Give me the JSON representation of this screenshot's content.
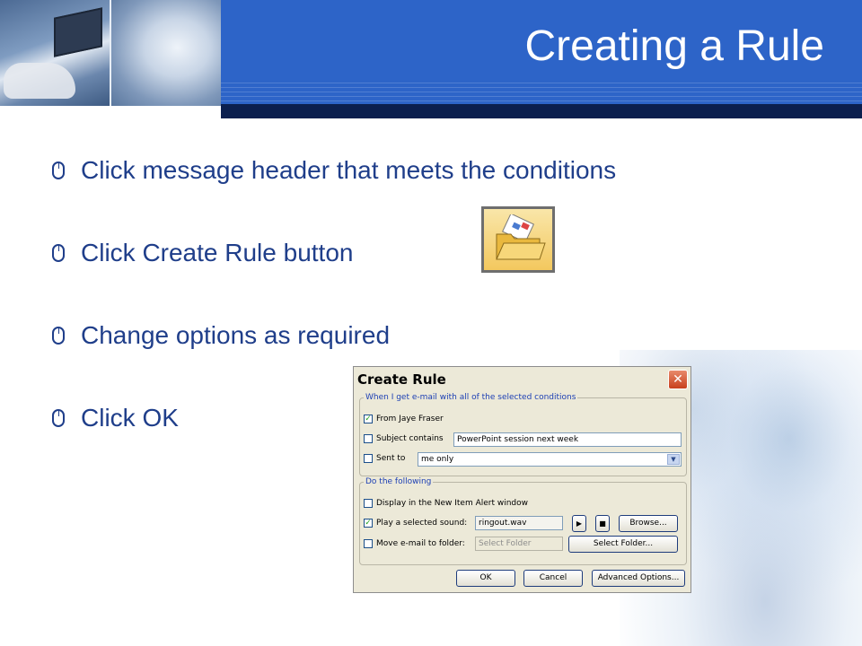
{
  "slide": {
    "title": "Creating a Rule",
    "bullets": [
      "Click message header that meets the conditions",
      "Click Create Rule button",
      "Change options as required",
      "Click OK"
    ]
  },
  "dialog": {
    "title": "Create Rule",
    "close_glyph": "✕",
    "conditions_legend": "When I get e-mail with all of the selected conditions",
    "from_label": "From Jaye Fraser",
    "from_checked": true,
    "subject_label": "Subject contains",
    "subject_checked": false,
    "subject_value": "PowerPoint session next week",
    "sent_to_label": "Sent to",
    "sent_to_checked": false,
    "sent_to_value": "me only",
    "actions_legend": "Do the following",
    "alert_label": "Display in the New Item Alert window",
    "alert_checked": false,
    "sound_label": "Play a selected sound:",
    "sound_checked": true,
    "sound_value": "ringout.wav",
    "play_glyph": "▶",
    "stop_glyph": "■",
    "browse_label": "Browse...",
    "move_label": "Move e-mail to folder:",
    "move_checked": false,
    "folder_value": "Select Folder",
    "select_folder_label": "Select Folder...",
    "ok_label": "OK",
    "cancel_label": "Cancel",
    "advanced_label": "Advanced Options..."
  },
  "colors": {
    "header_blue": "#2d64c8",
    "bullet_text": "#1f3e8a",
    "legend_blue": "#1c3fb4"
  },
  "icons": {
    "bullet": "mouse-icon",
    "create_rule": "create-rule-folder-icon"
  }
}
